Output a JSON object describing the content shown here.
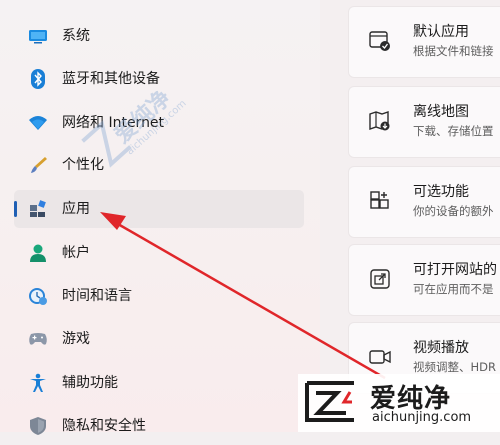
{
  "sidebar": {
    "items": [
      {
        "label": "系统",
        "icon": "monitor-icon"
      },
      {
        "label": "蓝牙和其他设备",
        "icon": "bluetooth-icon"
      },
      {
        "label": "网络和 Internet",
        "icon": "wifi-icon"
      },
      {
        "label": "个性化",
        "icon": "brush-icon"
      },
      {
        "label": "应用",
        "icon": "apps-icon",
        "selected": true
      },
      {
        "label": "帐户",
        "icon": "person-icon"
      },
      {
        "label": "时间和语言",
        "icon": "clock-globe-icon"
      },
      {
        "label": "游戏",
        "icon": "gamepad-icon"
      },
      {
        "label": "辅助功能",
        "icon": "accessibility-icon"
      },
      {
        "label": "隐私和安全性",
        "icon": "shield-icon"
      }
    ]
  },
  "main": {
    "cards": [
      {
        "title": "默认应用",
        "desc": "根据文件和链接",
        "icon": "default-apps-icon"
      },
      {
        "title": "离线地图",
        "desc": "下载、存储位置",
        "icon": "offline-map-icon"
      },
      {
        "title": "可选功能",
        "desc": "你的设备的额外",
        "icon": "optional-features-icon"
      },
      {
        "title": "可打开网站的",
        "desc": "可在应用而不是",
        "icon": "open-web-icon"
      },
      {
        "title": "视频播放",
        "desc": "视频调整、HDR",
        "icon": "video-icon"
      }
    ]
  },
  "watermark": {
    "text": "爱纯净",
    "url": "aichunjing.com"
  },
  "colors": {
    "accent": "#1f5fb4",
    "arrow": "#e0262a"
  }
}
